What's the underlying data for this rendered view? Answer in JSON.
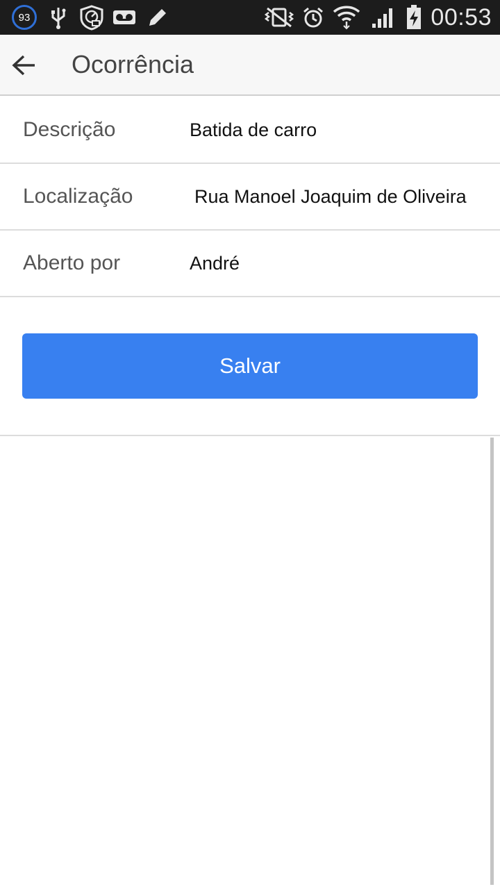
{
  "status_bar": {
    "notification_count": "93",
    "time": "00:53",
    "icons": [
      "usb-icon",
      "speed-shield-icon",
      "voicemail-icon",
      "pencil-icon",
      "vibrate-off-icon",
      "alarm-icon",
      "wifi-icon",
      "signal-icon",
      "battery-charging-icon"
    ]
  },
  "app_bar": {
    "title": "Ocorrência",
    "back_icon": "arrow-left-icon"
  },
  "form": {
    "rows": [
      {
        "label": "Descrição",
        "value": "Batida de carro"
      },
      {
        "label": "Localização",
        "value": "Rua Manoel Joaquim de Oliveira"
      },
      {
        "label": "Aberto por",
        "value": "André"
      }
    ]
  },
  "actions": {
    "save_label": "Salvar"
  },
  "colors": {
    "status_bar": "#1c1c1c",
    "app_bar": "#f7f7f7",
    "primary_button": "#3880f0",
    "divider": "#dcdcdc"
  }
}
